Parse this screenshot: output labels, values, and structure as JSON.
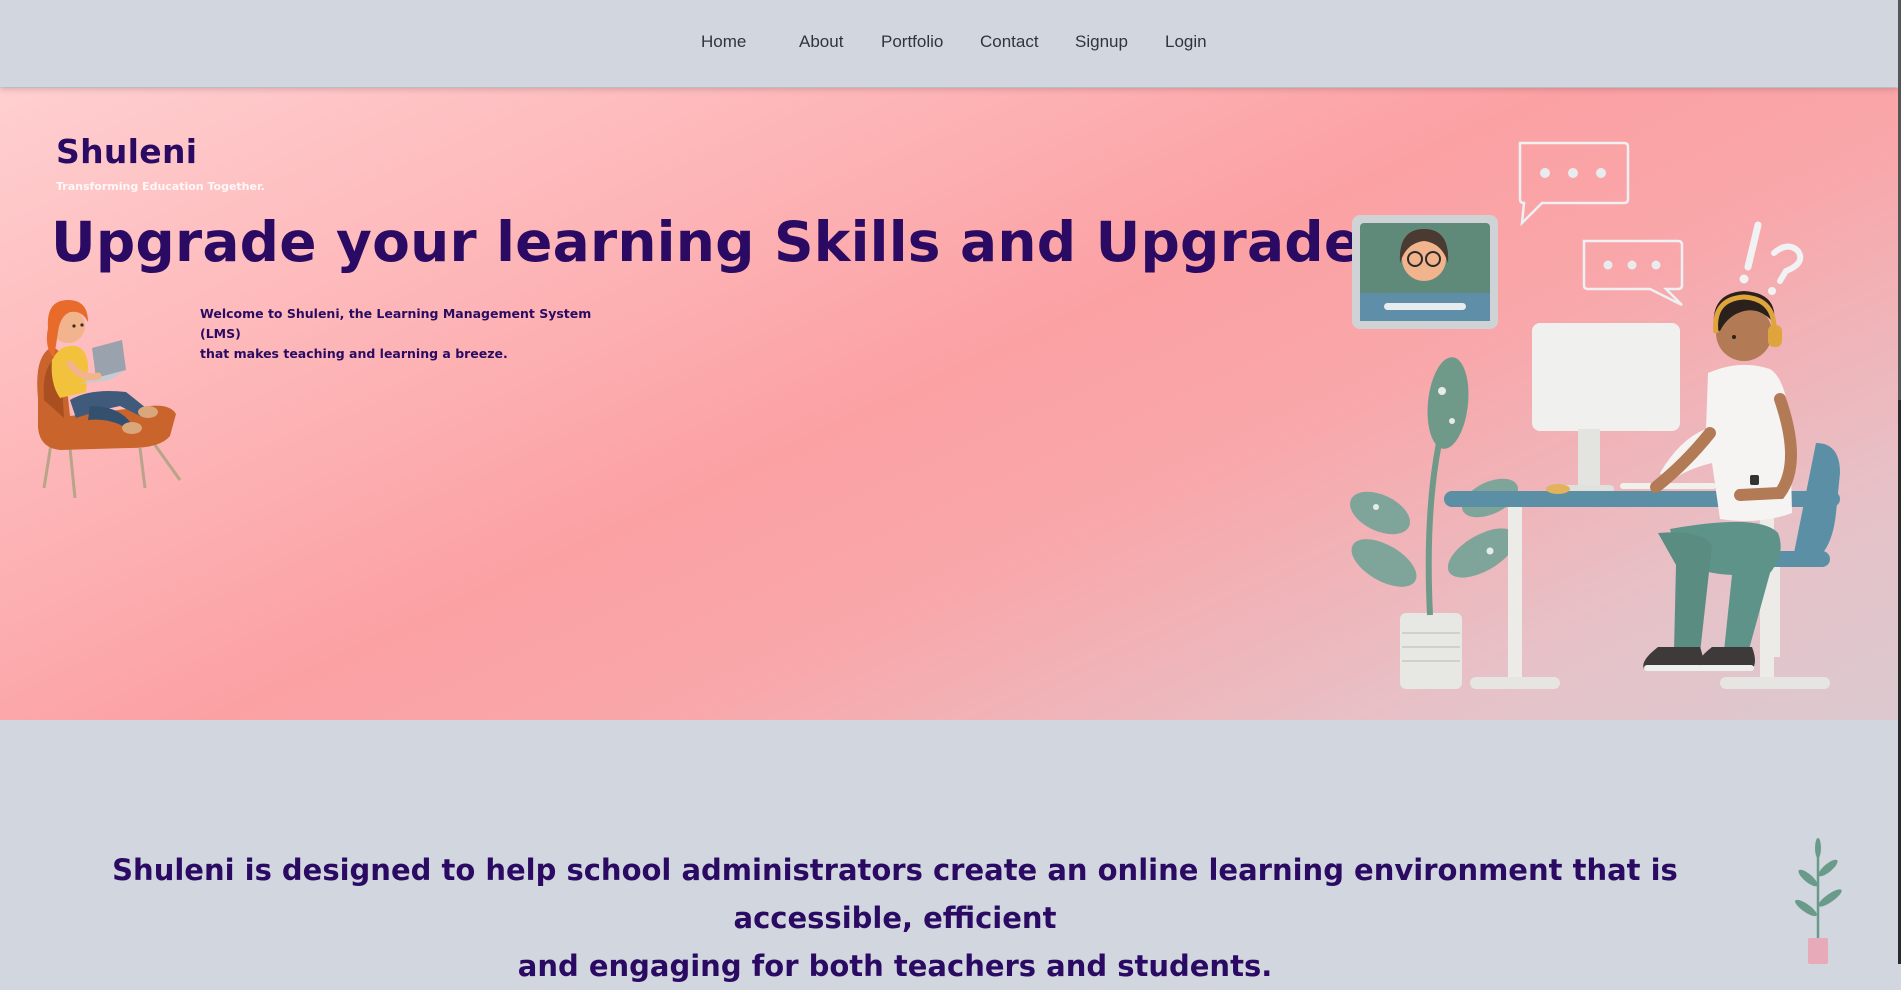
{
  "nav": {
    "items": [
      "Home",
      "About",
      "Portfolio",
      "Contact",
      "Signup",
      "Login"
    ]
  },
  "hero": {
    "brand": "Shuleni",
    "tagline": "Transforming Education Together.",
    "headline": "Upgrade your learning Skills and Upgrade Life",
    "welcome_line1": "Welcome to Shuleni, the Learning Management System (LMS)",
    "welcome_line2": "that makes teaching and learning a breeze."
  },
  "about": {
    "line1": "Shuleni is designed to help school administrators create an online learning environment that is accessible, efficient",
    "line2": "and engaging for both teachers and students."
  },
  "colors": {
    "brand_purple": "#2a0a63",
    "nav_bg": "#d2d6df",
    "hero_pink": "#fba1a4"
  },
  "icons": {
    "girl": "girl-in-armchair-illustration",
    "scene": "man-at-desk-illustration",
    "sprout": "plant-sprout-illustration"
  }
}
